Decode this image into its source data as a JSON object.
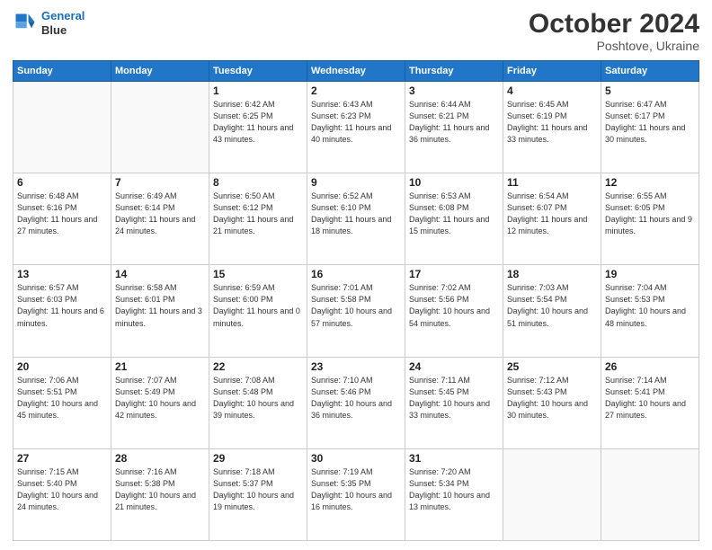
{
  "header": {
    "logo_line1": "General",
    "logo_line2": "Blue",
    "month": "October 2024",
    "location": "Poshtove, Ukraine"
  },
  "weekdays": [
    "Sunday",
    "Monday",
    "Tuesday",
    "Wednesday",
    "Thursday",
    "Friday",
    "Saturday"
  ],
  "weeks": [
    [
      {
        "day": "",
        "info": ""
      },
      {
        "day": "",
        "info": ""
      },
      {
        "day": "1",
        "info": "Sunrise: 6:42 AM\nSunset: 6:25 PM\nDaylight: 11 hours and 43 minutes."
      },
      {
        "day": "2",
        "info": "Sunrise: 6:43 AM\nSunset: 6:23 PM\nDaylight: 11 hours and 40 minutes."
      },
      {
        "day": "3",
        "info": "Sunrise: 6:44 AM\nSunset: 6:21 PM\nDaylight: 11 hours and 36 minutes."
      },
      {
        "day": "4",
        "info": "Sunrise: 6:45 AM\nSunset: 6:19 PM\nDaylight: 11 hours and 33 minutes."
      },
      {
        "day": "5",
        "info": "Sunrise: 6:47 AM\nSunset: 6:17 PM\nDaylight: 11 hours and 30 minutes."
      }
    ],
    [
      {
        "day": "6",
        "info": "Sunrise: 6:48 AM\nSunset: 6:16 PM\nDaylight: 11 hours and 27 minutes."
      },
      {
        "day": "7",
        "info": "Sunrise: 6:49 AM\nSunset: 6:14 PM\nDaylight: 11 hours and 24 minutes."
      },
      {
        "day": "8",
        "info": "Sunrise: 6:50 AM\nSunset: 6:12 PM\nDaylight: 11 hours and 21 minutes."
      },
      {
        "day": "9",
        "info": "Sunrise: 6:52 AM\nSunset: 6:10 PM\nDaylight: 11 hours and 18 minutes."
      },
      {
        "day": "10",
        "info": "Sunrise: 6:53 AM\nSunset: 6:08 PM\nDaylight: 11 hours and 15 minutes."
      },
      {
        "day": "11",
        "info": "Sunrise: 6:54 AM\nSunset: 6:07 PM\nDaylight: 11 hours and 12 minutes."
      },
      {
        "day": "12",
        "info": "Sunrise: 6:55 AM\nSunset: 6:05 PM\nDaylight: 11 hours and 9 minutes."
      }
    ],
    [
      {
        "day": "13",
        "info": "Sunrise: 6:57 AM\nSunset: 6:03 PM\nDaylight: 11 hours and 6 minutes."
      },
      {
        "day": "14",
        "info": "Sunrise: 6:58 AM\nSunset: 6:01 PM\nDaylight: 11 hours and 3 minutes."
      },
      {
        "day": "15",
        "info": "Sunrise: 6:59 AM\nSunset: 6:00 PM\nDaylight: 11 hours and 0 minutes."
      },
      {
        "day": "16",
        "info": "Sunrise: 7:01 AM\nSunset: 5:58 PM\nDaylight: 10 hours and 57 minutes."
      },
      {
        "day": "17",
        "info": "Sunrise: 7:02 AM\nSunset: 5:56 PM\nDaylight: 10 hours and 54 minutes."
      },
      {
        "day": "18",
        "info": "Sunrise: 7:03 AM\nSunset: 5:54 PM\nDaylight: 10 hours and 51 minutes."
      },
      {
        "day": "19",
        "info": "Sunrise: 7:04 AM\nSunset: 5:53 PM\nDaylight: 10 hours and 48 minutes."
      }
    ],
    [
      {
        "day": "20",
        "info": "Sunrise: 7:06 AM\nSunset: 5:51 PM\nDaylight: 10 hours and 45 minutes."
      },
      {
        "day": "21",
        "info": "Sunrise: 7:07 AM\nSunset: 5:49 PM\nDaylight: 10 hours and 42 minutes."
      },
      {
        "day": "22",
        "info": "Sunrise: 7:08 AM\nSunset: 5:48 PM\nDaylight: 10 hours and 39 minutes."
      },
      {
        "day": "23",
        "info": "Sunrise: 7:10 AM\nSunset: 5:46 PM\nDaylight: 10 hours and 36 minutes."
      },
      {
        "day": "24",
        "info": "Sunrise: 7:11 AM\nSunset: 5:45 PM\nDaylight: 10 hours and 33 minutes."
      },
      {
        "day": "25",
        "info": "Sunrise: 7:12 AM\nSunset: 5:43 PM\nDaylight: 10 hours and 30 minutes."
      },
      {
        "day": "26",
        "info": "Sunrise: 7:14 AM\nSunset: 5:41 PM\nDaylight: 10 hours and 27 minutes."
      }
    ],
    [
      {
        "day": "27",
        "info": "Sunrise: 7:15 AM\nSunset: 5:40 PM\nDaylight: 10 hours and 24 minutes."
      },
      {
        "day": "28",
        "info": "Sunrise: 7:16 AM\nSunset: 5:38 PM\nDaylight: 10 hours and 21 minutes."
      },
      {
        "day": "29",
        "info": "Sunrise: 7:18 AM\nSunset: 5:37 PM\nDaylight: 10 hours and 19 minutes."
      },
      {
        "day": "30",
        "info": "Sunrise: 7:19 AM\nSunset: 5:35 PM\nDaylight: 10 hours and 16 minutes."
      },
      {
        "day": "31",
        "info": "Sunrise: 7:20 AM\nSunset: 5:34 PM\nDaylight: 10 hours and 13 minutes."
      },
      {
        "day": "",
        "info": ""
      },
      {
        "day": "",
        "info": ""
      }
    ]
  ]
}
